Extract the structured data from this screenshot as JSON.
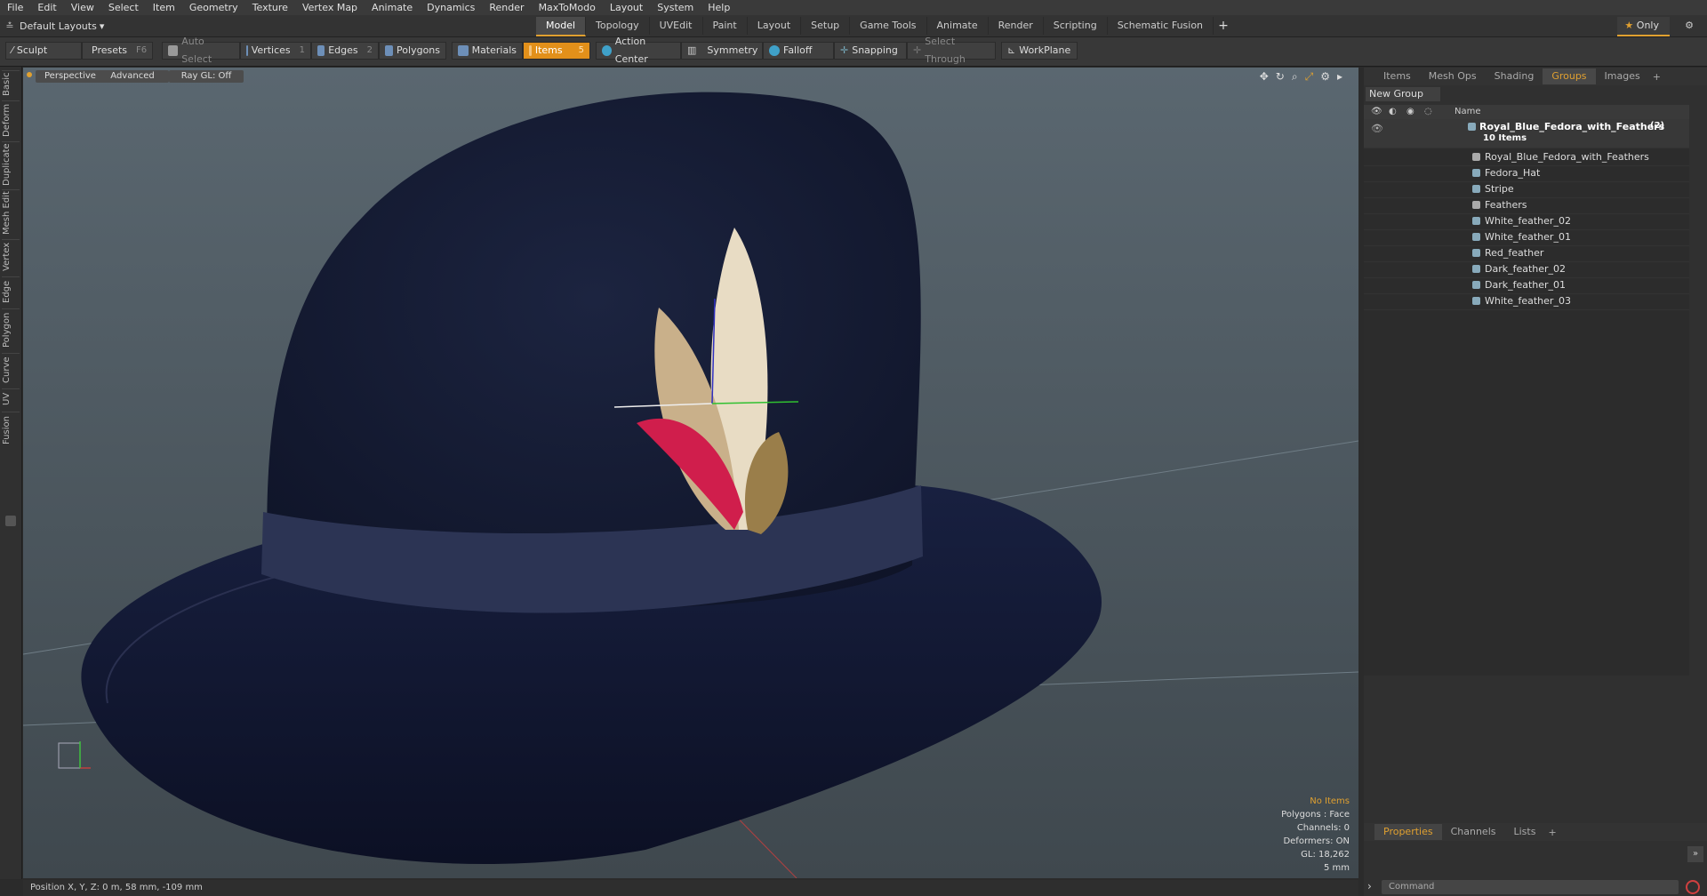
{
  "menu": [
    "File",
    "Edit",
    "View",
    "Select",
    "Item",
    "Geometry",
    "Texture",
    "Vertex Map",
    "Animate",
    "Dynamics",
    "Render",
    "MaxToModo",
    "Layout",
    "System",
    "Help"
  ],
  "layout_picker": "Default Layouts",
  "mode_tabs": [
    "Model",
    "Topology",
    "UVEdit",
    "Paint",
    "Layout",
    "Setup",
    "Game Tools",
    "Animate",
    "Render",
    "Scripting",
    "Schematic Fusion"
  ],
  "only_label": "Only",
  "toolbar": {
    "sculpt": "Sculpt",
    "presets": "Presets",
    "presets_key": "F6",
    "auto_select": "Auto Select",
    "vertices": "Vertices",
    "vertices_key": "1",
    "edges": "Edges",
    "edges_key": "2",
    "polygons": "Polygons",
    "materials": "Materials",
    "items": "Items",
    "items_key": "5",
    "action_center": "Action Center",
    "symmetry": "Symmetry",
    "falloff": "Falloff",
    "snapping": "Snapping",
    "select_through": "Select Through",
    "workplane": "WorkPlane"
  },
  "left_tabs": [
    "Basic",
    "Deform",
    "Duplicate",
    "Mesh Edit",
    "Vertex",
    "Edge",
    "Polygon",
    "Curve",
    "UV",
    "Fusion"
  ],
  "viewport": {
    "perspective": "Perspective",
    "advanced": "Advanced",
    "raygl": "Ray GL: Off",
    "info": {
      "items": "No Items",
      "polygons": "Polygons : Face",
      "channels": "Channels: 0",
      "deformers": "Deformers: ON",
      "gl": "GL: 18,262",
      "scale": "5 mm"
    }
  },
  "status": "Position X, Y, Z:  0 m, 58 mm, -109 mm",
  "right_panel": {
    "tabs": [
      "Items",
      "Mesh Ops",
      "Shading",
      "Groups",
      "Images"
    ],
    "active_tab": "Groups",
    "new_group": "New Group",
    "name_header": "Name",
    "group": {
      "name": "Royal_Blue_Fedora_with_Feathers",
      "count": "(2)",
      "sub": "10 Items"
    },
    "items": [
      "Royal_Blue_Fedora_with_Feathers",
      "Fedora_Hat",
      "Stripe",
      "Feathers",
      "White_feather_02",
      "White_feather_01",
      "Red_feather",
      "Dark_feather_02",
      "Dark_feather_01",
      "White_feather_03"
    ],
    "props_tabs": [
      "Properties",
      "Channels",
      "Lists"
    ],
    "command_placeholder": "Command"
  }
}
